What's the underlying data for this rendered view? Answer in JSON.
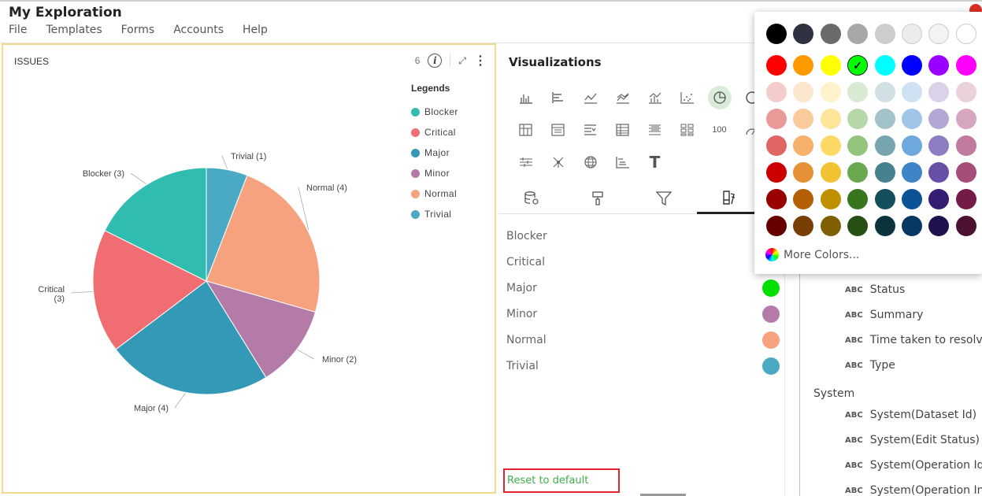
{
  "app": {
    "title": "My Exploration"
  },
  "menu": [
    {
      "label": "File"
    },
    {
      "label": "Templates"
    },
    {
      "label": "Forms"
    },
    {
      "label": "Accounts"
    },
    {
      "label": "Help"
    }
  ],
  "chart_panel": {
    "title": "ISSUES",
    "count": "6",
    "legend_title": "Legends"
  },
  "chart_data": {
    "type": "pie",
    "title": "ISSUES",
    "slices": [
      {
        "label": "Trivial",
        "value": 1,
        "color": "#4aa9c3"
      },
      {
        "label": "Normal",
        "value": 4,
        "color": "#f6a27e"
      },
      {
        "label": "Minor",
        "value": 2,
        "color": "#b57ba8"
      },
      {
        "label": "Major",
        "value": 4,
        "color": "#3399b6"
      },
      {
        "label": "Critical",
        "value": 3,
        "color": "#f06e72"
      },
      {
        "label": "Blocker",
        "value": 3,
        "color": "#30bdb0"
      }
    ],
    "data_labels": [
      "Trivial (1)",
      "Normal (4)",
      "Minor (2)",
      "Major (4)",
      "Critical\n(3)",
      "Blocker (3)"
    ],
    "legend": [
      "Blocker",
      "Critical",
      "Major",
      "Minor",
      "Normal",
      "Trivial"
    ],
    "legend_placement": "right"
  },
  "visualizations": {
    "title": "Visualizations",
    "text_100": "100",
    "text_T": "T",
    "tab_icons": [
      "data-icon",
      "format-icon",
      "filter-icon",
      "color-icon"
    ]
  },
  "color_list": [
    {
      "label": "Blocker",
      "color": ""
    },
    {
      "label": "Critical",
      "color": ""
    },
    {
      "label": "Major",
      "color": "#00e000"
    },
    {
      "label": "Minor",
      "color": "#b57ba8"
    },
    {
      "label": "Normal",
      "color": "#f6a27e"
    },
    {
      "label": "Trivial",
      "color": "#4aa9c3"
    }
  ],
  "reset_label": "Reset to default",
  "fields": {
    "abc": "ABC",
    "items_top": [
      "Status",
      "Summary",
      "Time taken to resolve",
      "Type"
    ],
    "group": "System",
    "items_system": [
      "System(Dataset Id)",
      "System(Edit Status)",
      "System(Operation Id)",
      "System(Operation Inst"
    ]
  },
  "picker": {
    "rows": [
      [
        "#000000",
        "#2f3240",
        "#6b6b6b",
        "#a8a8a8",
        "#cdcdcd",
        "#ececec",
        "#f3f3f3",
        "#ffffff"
      ],
      [
        "#ff0000",
        "#ff9900",
        "#ffff00",
        "#00ff00",
        "#00ffff",
        "#0000ff",
        "#9900ff",
        "#ff00ff"
      ],
      [
        "#f4cccc",
        "#fce5cd",
        "#fff2cc",
        "#d9ead3",
        "#d0e0e3",
        "#cfe2f3",
        "#d9d2e9",
        "#ead1dc"
      ],
      [
        "#ea9999",
        "#f9cb9c",
        "#ffe599",
        "#b6d7a8",
        "#a2c4c9",
        "#9fc5e8",
        "#b4a7d6",
        "#d5a6bd"
      ],
      [
        "#e06666",
        "#f6b26b",
        "#ffd966",
        "#93c47d",
        "#76a5af",
        "#6fa8dc",
        "#8e7cc3",
        "#c27ba0"
      ],
      [
        "#cc0000",
        "#e69138",
        "#f1c232",
        "#6aa84f",
        "#45818e",
        "#3d85c6",
        "#674ea7",
        "#a64d79"
      ],
      [
        "#990000",
        "#b45f06",
        "#bf9000",
        "#38761d",
        "#134f5c",
        "#0b5394",
        "#351c75",
        "#741b47"
      ],
      [
        "#660000",
        "#783f04",
        "#7f6000",
        "#274e13",
        "#0c343d",
        "#073763",
        "#20124d",
        "#4c1130"
      ]
    ],
    "selected": "#00ff00",
    "check": "✓",
    "more_colors": "More Colors..."
  }
}
